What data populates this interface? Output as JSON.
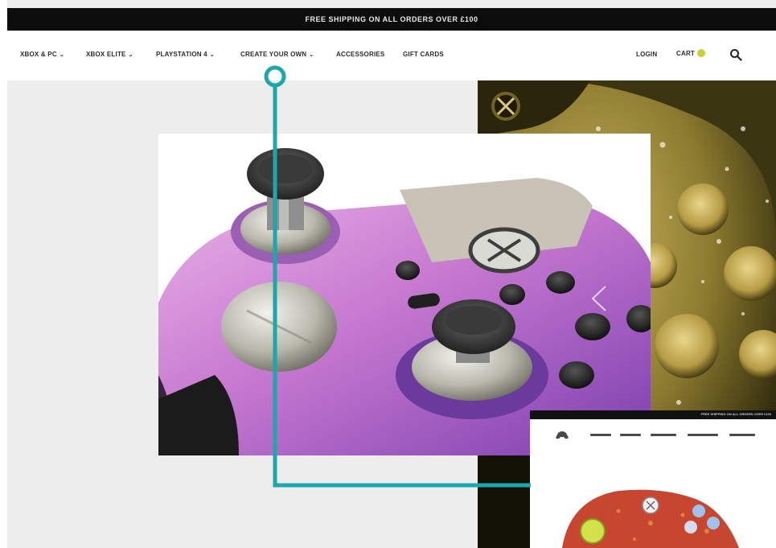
{
  "announcement": "FREE SHIPPING ON ALL ORDERS OVER £100",
  "nav": {
    "items": [
      {
        "label": "XBOX & PC",
        "has_dropdown": true
      },
      {
        "label": "XBOX ELITE",
        "has_dropdown": true
      },
      {
        "label": "PLAYSTATION 4",
        "has_dropdown": true
      },
      {
        "label": "CREATE YOUR OWN",
        "has_dropdown": true
      },
      {
        "label": "ACCESSORIES",
        "has_dropdown": false
      },
      {
        "label": "GIFT CARDS",
        "has_dropdown": false
      }
    ],
    "login": "LOGIN",
    "cart": "CART",
    "search_icon": "search-icon"
  },
  "colors": {
    "announcement_bg": "#0c0c0c",
    "callout": "#1ea6ad",
    "cart_badge": "#c9cf35",
    "controller_purple": "#c97ad6",
    "controller_gold": "#b89e4a"
  }
}
